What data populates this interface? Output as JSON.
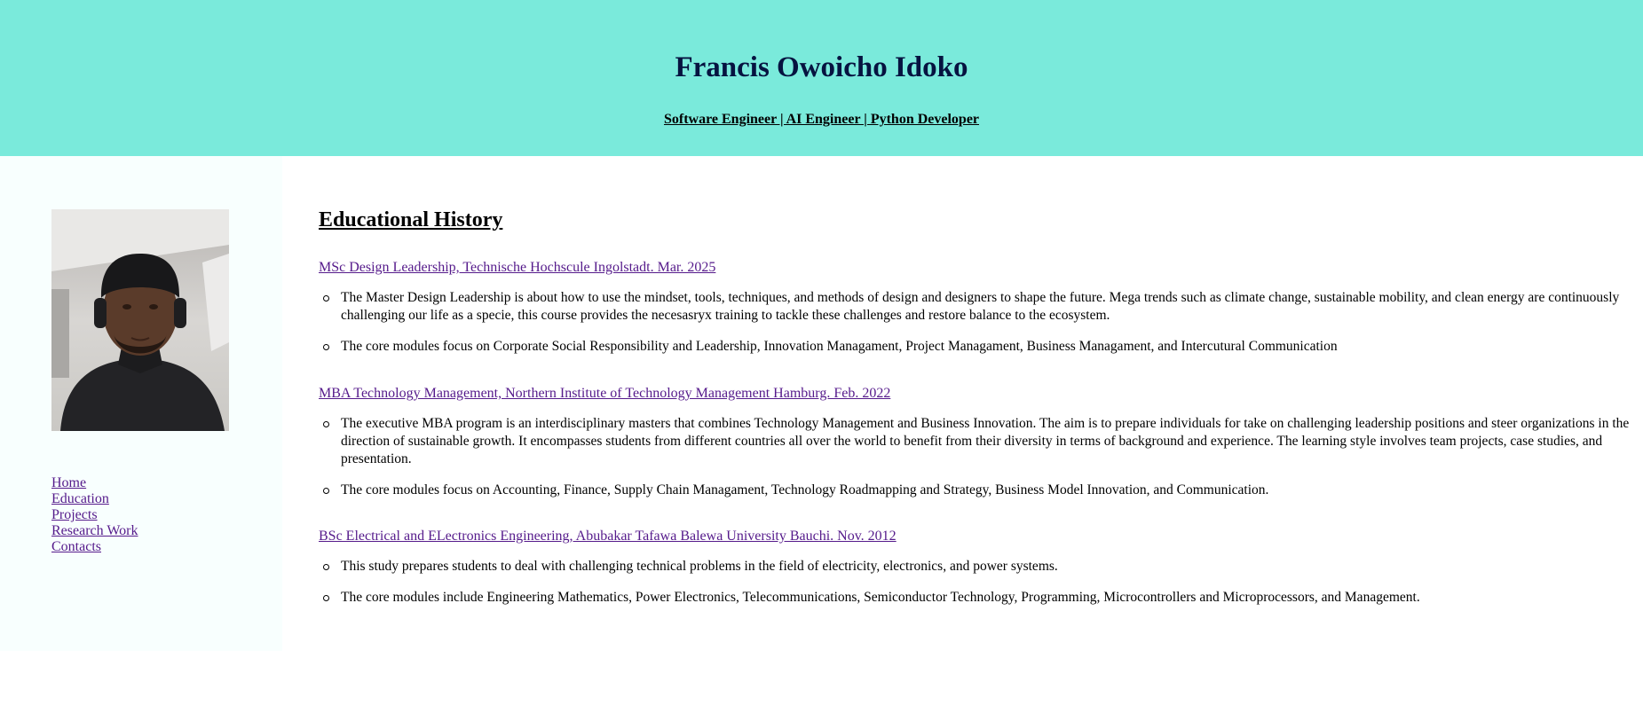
{
  "header": {
    "name": "Francis Owoicho Idoko",
    "subtitle": "Software Engineer | AI Engineer | Python Developer"
  },
  "sidebar": {
    "nav": [
      {
        "label": "Home"
      },
      {
        "label": "Education"
      },
      {
        "label": "Projects"
      },
      {
        "label": "Research Work"
      },
      {
        "label": "Contacts"
      }
    ]
  },
  "main": {
    "heading": "Educational History",
    "degrees": [
      {
        "title": "MSc Design Leadership, Technische Hochscule Ingolstadt. Mar. 2025",
        "points": [
          "The Master Design Leadership is about how to use the mindset, tools, techniques, and methods of design and designers to shape the future. Mega trends such as climate change, sustainable mobility, and clean energy are continuously challenging our life as a specie, this course provides the necesasryx training to tackle these challenges and restore balance to the ecosystem.",
          "The core modules focus on Corporate Social Responsibility and Leadership, Innovation Managament, Project Managament, Business Managament, and Intercutural Communication"
        ]
      },
      {
        "title": "MBA Technology Management, Northern Institute of Technology Management Hamburg. Feb. 2022",
        "points": [
          "The executive MBA program is an interdisciplinary masters that combines Technology Management and Business Innovation. The aim is to prepare individuals for take on challenging leadership positions and steer organizations in the direction of sustainable growth. It encompasses students from different countries all over the world to benefit from their diversity in terms of background and experience. The learning style involves team projects, case studies, and presentation.",
          "The core modules focus on Accounting, Finance, Supply Chain Managament, Technology Roadmapping and Strategy, Business Model Innovation, and Communication."
        ]
      },
      {
        "title": "BSc Electrical and ELectronics Engineering, Abubakar Tafawa Balewa University Bauchi. Nov. 2012",
        "points": [
          "This study prepares students to deal with challenging technical problems in the field of electricity, electronics, and power systems.",
          "The core modules include Engineering Mathematics, Power Electronics, Telecommunications, Semiconductor Technology, Programming, Microcontrollers and Microprocessors, and Management."
        ]
      }
    ]
  }
}
